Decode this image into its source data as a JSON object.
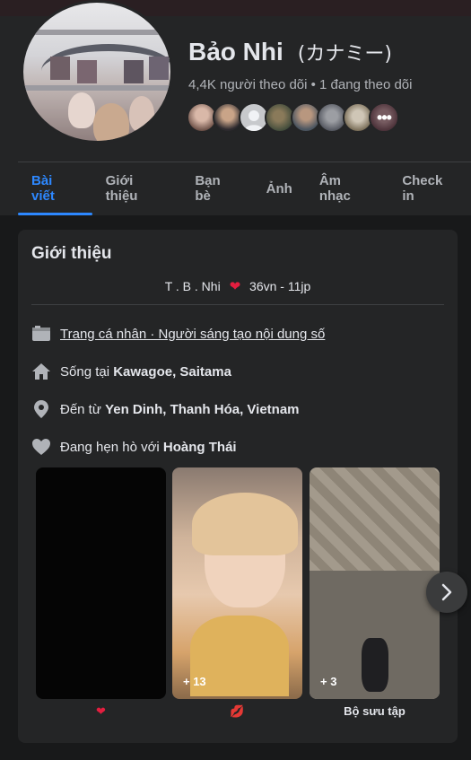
{
  "profile": {
    "name": "Bảo Nhi",
    "alt_name": "(カナミー)",
    "followers_line": "4,4K người theo dõi • 1 đang theo dõi",
    "friends_more_icon": "more-dots-icon"
  },
  "tabs": [
    {
      "label": "Bài viết",
      "active": true
    },
    {
      "label": "Giới thiệu",
      "active": false
    },
    {
      "label": "Bạn bè",
      "active": false
    },
    {
      "label": "Ảnh",
      "active": false
    },
    {
      "label": "Âm nhạc",
      "active": false
    },
    {
      "label": "Check in",
      "active": false
    }
  ],
  "intro": {
    "title": "Giới thiệu",
    "bio_left": "T . B . Nhi",
    "bio_right": "36vn - 11jp",
    "page_type": "Trang cá nhân · Người sáng tạo nội dung số",
    "lives_prefix": "Sống tại",
    "lives_place": "Kawagoe, Saitama",
    "from_prefix": "Đến từ",
    "from_place": "Yen Dinh, Thanh Hóa, Vietnam",
    "relationship_prefix": "Đang hẹn hò với",
    "relationship_person": "Hoàng Thái"
  },
  "highlights": [
    {
      "label": "❤",
      "count": ""
    },
    {
      "label": "💋",
      "count": "+ 13"
    },
    {
      "label": "Bộ sưu tập",
      "count": "+ 3"
    }
  ],
  "colors": {
    "accent": "#2d88ff",
    "background": "#18191a",
    "surface": "#242526",
    "heart": "#e41e3f"
  }
}
